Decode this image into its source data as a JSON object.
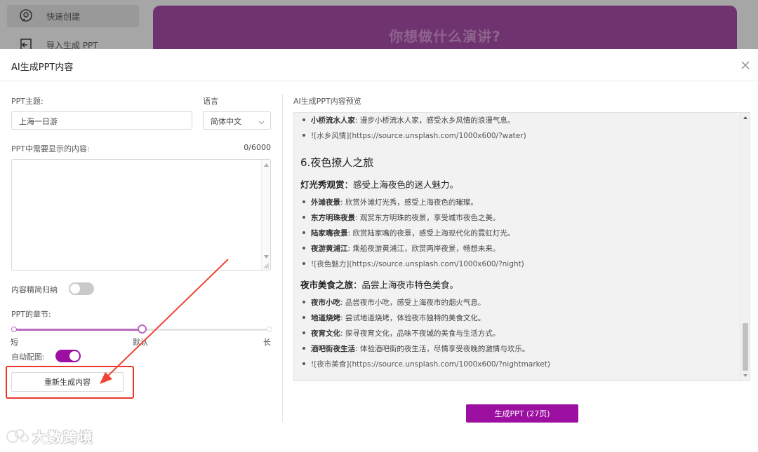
{
  "background": {
    "nav": [
      {
        "label": "快速创建",
        "icon": "brain-icon",
        "active": true
      },
      {
        "label": "导入生成 PPT",
        "icon": "import-icon",
        "active": false
      }
    ],
    "banner_text": "你想做什么演讲?"
  },
  "modal": {
    "title": "AI生成PPT内容",
    "left": {
      "topic_label": "PPT主题:",
      "topic_value": "上海一日游",
      "language_label": "语言",
      "language_value": "简体中文",
      "content_label": "PPT中需要显示的内容:",
      "content_counter": "0/6000",
      "content_value": "",
      "summarize_label": "内容精简归纳",
      "summarize_on": false,
      "chapters_label": "PPT的章节:",
      "chapters_ticks": [
        "短",
        "默认",
        "长"
      ],
      "chapters_level": 0.5,
      "auto_image_label": "自动配图:",
      "auto_image_on": true,
      "regenerate_label": "重新生成内容"
    },
    "right": {
      "preview_title": "AI生成PPT内容预览",
      "lines": [
        {
          "kind": "bullet",
          "bold": "小桥流水人家",
          "text": ": 漫步小桥流水人家，感受水乡风情的浪漫气息。"
        },
        {
          "kind": "link",
          "text": "![水乡风情](https://source.unsplash.com/1000x600/?water)"
        },
        {
          "kind": "h2",
          "text": "6.夜色撩人之旅"
        },
        {
          "kind": "h3",
          "bold": "灯光秀观赏",
          "text": "：感受上海夜色的迷人魅力。"
        },
        {
          "kind": "bullet",
          "bold": "外滩夜景",
          "text": ": 欣赏外滩灯光秀，感受上海夜色的璀璨。"
        },
        {
          "kind": "bullet",
          "bold": "东方明珠夜景",
          "text": ": 观赏东方明珠的夜景，享受城市夜色之美。"
        },
        {
          "kind": "bullet",
          "bold": "陆家嘴夜景",
          "text": ": 欣赏陆家嘴的夜景，感受上海现代化的霓虹灯光。"
        },
        {
          "kind": "bullet",
          "bold": "夜游黄浦江",
          "text": ": 乘船夜游黄浦江，欣赏两岸夜景，畅想未来。"
        },
        {
          "kind": "link",
          "text": "![夜色魅力](https://source.unsplash.com/1000x600/?night)"
        },
        {
          "kind": "h3",
          "bold": "夜市美食之旅",
          "text": "：品尝上海夜市特色美食。"
        },
        {
          "kind": "bullet",
          "bold": "夜市小吃",
          "text": ": 品尝夜市小吃，感受上海夜市的烟火气息。"
        },
        {
          "kind": "bullet",
          "bold": "地道烧烤",
          "text": ": 尝试地道烧烤，体验夜市独特的美食文化。"
        },
        {
          "kind": "bullet",
          "bold": "夜宵文化",
          "text": ": 探寻夜宵文化，品味不夜城的美食与生活方式。"
        },
        {
          "kind": "bullet",
          "bold": "酒吧街夜生活",
          "text": ": 体验酒吧街的夜生活，尽情享受夜晚的激情与欢乐。"
        },
        {
          "kind": "link",
          "text": "![夜市美食](https://source.unsplash.com/1000x600/?nightmarket)"
        }
      ],
      "generate_label": "生成PPT (27页)"
    }
  },
  "watermark": "大数跨境",
  "colors": {
    "accent": "#9c0fa0",
    "annotation": "#e8372b"
  }
}
